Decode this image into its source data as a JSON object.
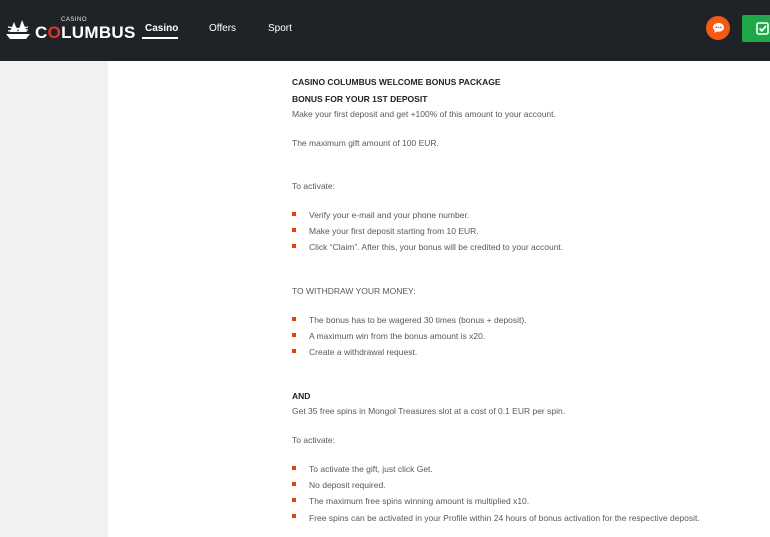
{
  "header": {
    "logo": {
      "small": "CASINO",
      "big_prefix": "C",
      "big_o": "O",
      "big_rest": "LUMBUS"
    },
    "nav": [
      {
        "label": "Casino",
        "active": true
      },
      {
        "label": "Offers",
        "active": false
      },
      {
        "label": "Sport",
        "active": false
      }
    ],
    "chat_icon": "chat-bubble-icon",
    "action_icon": "checkbox-icon",
    "colors": {
      "bar": "#1f2328",
      "chat": "#f35a16",
      "action": "#1ea84a"
    }
  },
  "content": {
    "title": "CASINO COLUMBUS WELCOME BONUS PACKAGE",
    "subtitle": "BONUS FOR YOUR 1ST DEPOSIT",
    "intro": "Make your first deposit and get +100% of this amount to your account.",
    "max_gift": "The maximum gift amount of 100 EUR.",
    "activate_label_1": "To activate:",
    "activate_steps_1": [
      "Verify your e-mail and your phone number.",
      "Make your first deposit starting from 10 EUR.",
      "Click “Claim”. After this, your bonus will be credited to your account."
    ],
    "withdraw_label": "TO WITHDRAW YOUR MONEY:",
    "withdraw_steps": [
      "The bonus has to be wagered 30 times (bonus + deposit).",
      "A maximum win from the bonus amount is x20.",
      "Create a withdrawal request."
    ],
    "and_label": "AND",
    "spins_text": "Get 35 free spins in Mongol Treasures slot at a cost of 0.1 EUR per spin.",
    "activate_label_2": "To activate:",
    "activate_steps_2": [
      "To activate the gift, just click Get.",
      "No deposit required.",
      "The maximum free spins winning amount is multiplied x10.",
      "Free spins can be activated in your Profile within 24 hours of bonus activation for the respective deposit."
    ],
    "bullet_color": "#e8400c"
  }
}
